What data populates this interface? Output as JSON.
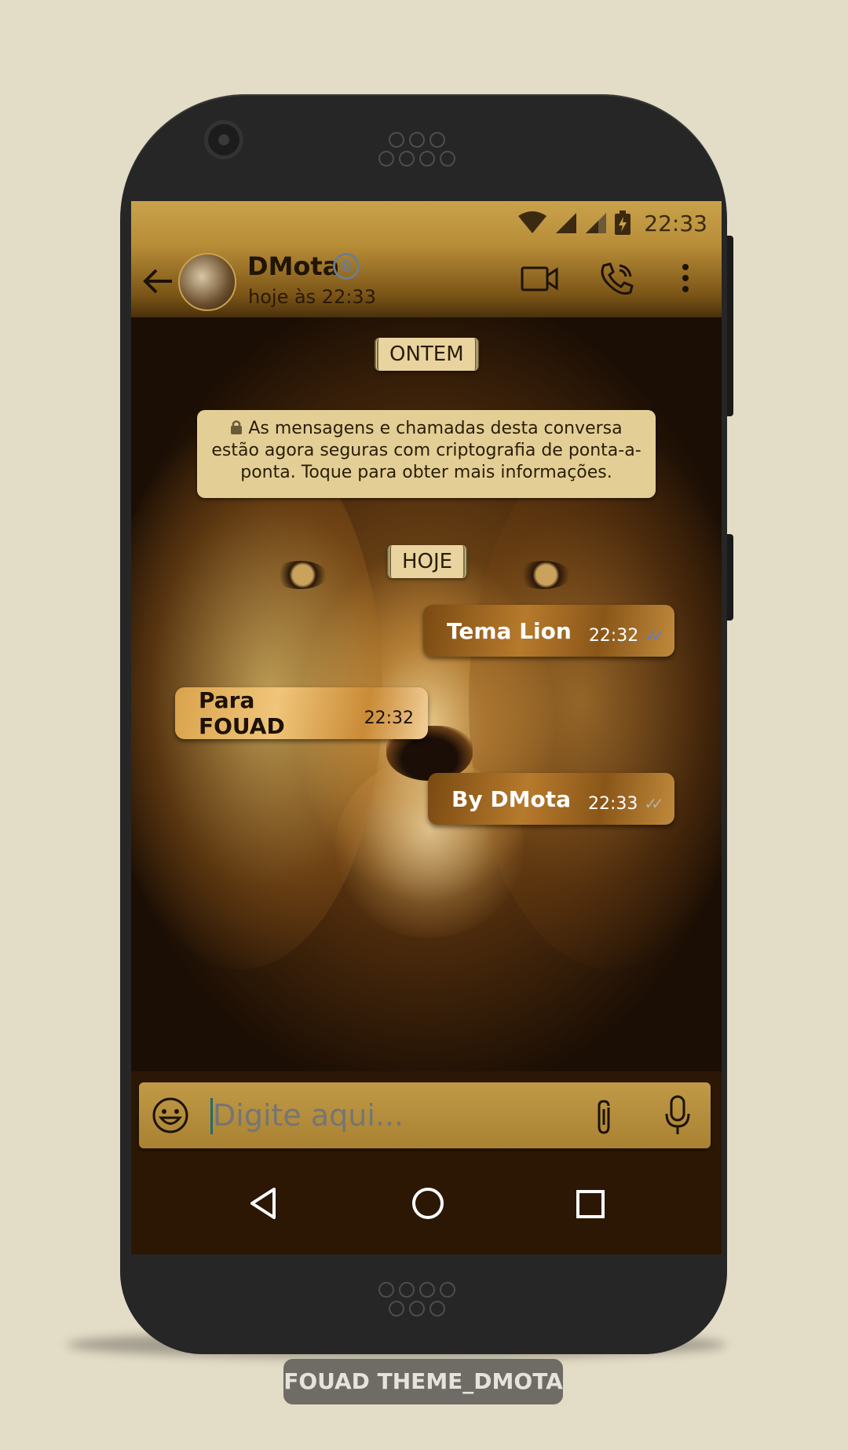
{
  "status_bar": {
    "time": "22:33"
  },
  "app_bar": {
    "contact_name": "DMota",
    "registered_mark": "®",
    "last_seen": "hoje às 22:33"
  },
  "chat": {
    "date_chips": [
      "ONTEM",
      "HOJE"
    ],
    "encryption_notice": "As mensagens e chamadas desta conversa estão agora seguras com criptografia de ponta-a-ponta. Toque para obter mais informações.",
    "messages": [
      {
        "direction": "outgoing",
        "text": "Tema Lion",
        "time": "22:32",
        "status": "read"
      },
      {
        "direction": "incoming",
        "text": "Para FOUAD",
        "time": "22:32"
      },
      {
        "direction": "outgoing",
        "text": "By DMota",
        "time": "22:33",
        "status": "delivered"
      }
    ]
  },
  "input": {
    "placeholder": "Digite aqui..."
  },
  "icons": {
    "back": "arrow-left-icon",
    "video": "video-camera-icon",
    "call": "phone-call-icon",
    "menu": "more-vert-icon",
    "emoji": "emoji-icon",
    "attach": "paperclip-icon",
    "mic": "microphone-icon",
    "lock": "lock-icon"
  },
  "colors": {
    "accent_gold": "#c9a24c",
    "dark_brown": "#2c1705",
    "read_tick": "#5a7dd8"
  },
  "watermark": "FOUAD THEME_DMOTA"
}
